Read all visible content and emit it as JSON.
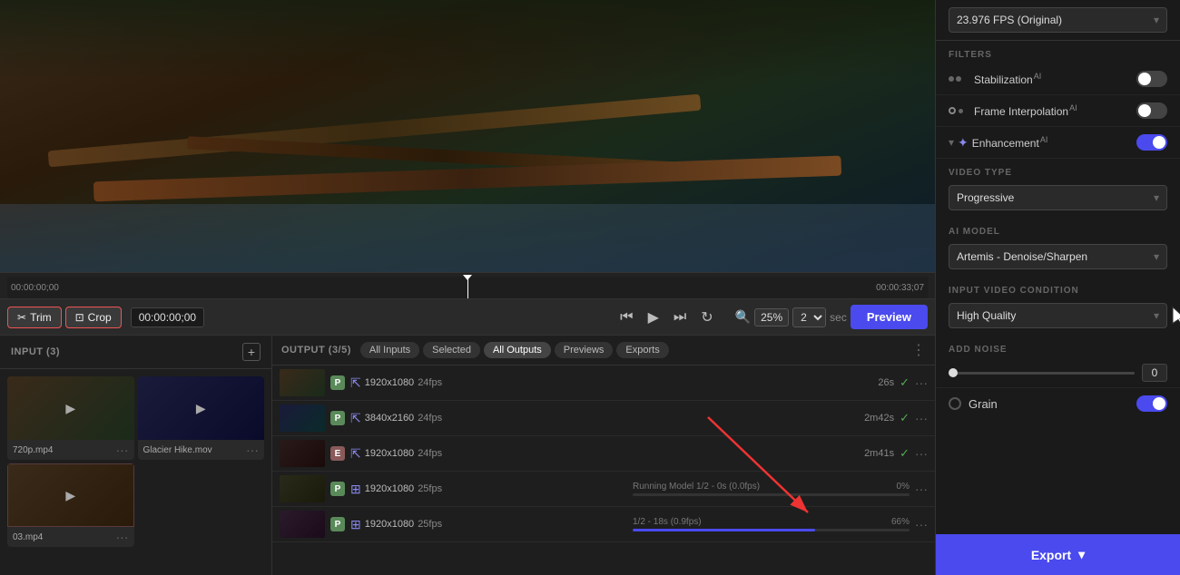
{
  "toolbar": {
    "trim_label": "Trim",
    "crop_label": "Crop",
    "timecode": "00:00:00;00",
    "time_start": "00:00:00;00",
    "time_end": "00:00:33;07",
    "time_center": "00:00:00;00",
    "zoom_value": "25%",
    "scale_value": "2",
    "sec_label": "sec",
    "preview_label": "Preview"
  },
  "input_panel": {
    "title": "INPUT (3)",
    "items": [
      {
        "label": "720p.mp4",
        "type": "video"
      },
      {
        "label": "Glacier Hike.mov",
        "type": "video"
      },
      {
        "label": "03.mp4",
        "type": "video",
        "active": true
      }
    ]
  },
  "output_panel": {
    "title": "OUTPUT (3/5)",
    "tabs": [
      {
        "label": "All Inputs",
        "active": false
      },
      {
        "label": "Selected",
        "active": false
      },
      {
        "label": "All Outputs",
        "active": true
      },
      {
        "label": "Previews",
        "active": false
      },
      {
        "label": "Exports",
        "active": false
      }
    ],
    "rows": [
      {
        "badge": "P",
        "badge_type": "p",
        "res": "1920x1080",
        "fps": "24fps",
        "duration": "26s",
        "check": true,
        "upscale": true
      },
      {
        "badge": "P",
        "badge_type": "p",
        "res": "3840x2160",
        "fps": "24fps",
        "duration": "2m42s",
        "check": true,
        "upscale": true
      },
      {
        "badge": "E",
        "badge_type": "e",
        "res": "1920x1080",
        "fps": "24fps",
        "duration": "2m41s",
        "check": true,
        "upscale": true
      },
      {
        "badge": "P",
        "badge_type": "p",
        "res": "1920x1080",
        "fps": "25fps",
        "progress_label": "Running Model  1/2 - 0s (0.0fps)",
        "progress_pct": "0%",
        "progress_val": 0,
        "upscale": true
      },
      {
        "badge": "P",
        "badge_type": "p",
        "res": "1920x1080",
        "fps": "25fps",
        "progress_label": "1/2 - 18s (0.9fps)",
        "progress_pct": "66%",
        "progress_val": 66,
        "upscale": true
      }
    ]
  },
  "sidebar": {
    "fps_label": "23.976 FPS (Original)",
    "filters_title": "FILTERS",
    "stabilization_label": "Stabilization",
    "stabilization_on": false,
    "frame_interp_label": "Frame Interpolation",
    "frame_interp_on": false,
    "enhancement_label": "Enhancement",
    "enhancement_on": true,
    "video_type_title": "VIDEO TYPE",
    "video_type_value": "Progressive",
    "ai_model_title": "AI MODEL",
    "ai_model_value": "Artemis - Denoise/Sharpen",
    "input_condition_title": "INPUT VIDEO CONDITION",
    "input_condition_value": "High Quality",
    "add_noise_title": "ADD NOISE",
    "noise_value": "0",
    "grain_label": "Grain",
    "grain_on": true,
    "export_label": "Export"
  }
}
